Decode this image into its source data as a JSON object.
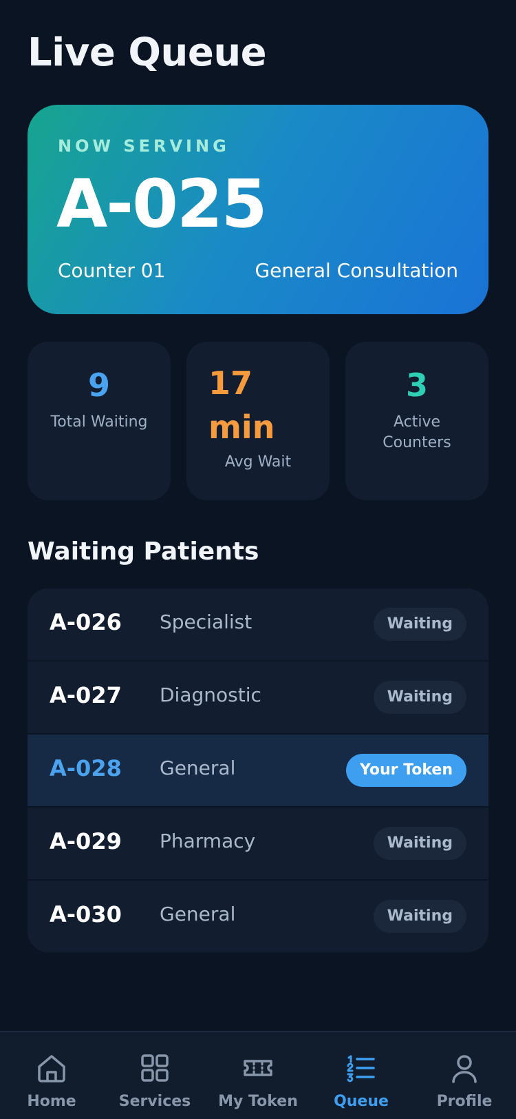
{
  "header": {
    "title": "Live Queue"
  },
  "now_serving": {
    "label": "NOW SERVING",
    "token": "A-025",
    "counter": "Counter 01",
    "service": "General Consultation"
  },
  "stats": [
    {
      "value": "9",
      "label": "Total Waiting",
      "color": "#4ba3f0"
    },
    {
      "value": "17 min",
      "value_line1": "17",
      "value_line2": "min",
      "label": "Avg Wait",
      "color": "#f59a3d"
    },
    {
      "value": "3",
      "label": "Active Counters",
      "label_line1": "Active",
      "label_line2": "Counters",
      "color": "#2ecfb5"
    }
  ],
  "waiting": {
    "title": "Waiting Patients",
    "rows": [
      {
        "token": "A-026",
        "service": "Specialist",
        "status": "Waiting"
      },
      {
        "token": "A-027",
        "service": "Diagnostic",
        "status": "Waiting"
      },
      {
        "token": "A-028",
        "service": "General",
        "status": "Your Token",
        "is_mine": true
      },
      {
        "token": "A-029",
        "service": "Pharmacy",
        "status": "Waiting"
      },
      {
        "token": "A-030",
        "service": "General",
        "status": "Waiting"
      }
    ]
  },
  "nav": {
    "active": "Queue",
    "items": [
      {
        "label": "Home",
        "icon": "home-icon"
      },
      {
        "label": "Services",
        "icon": "grid-icon"
      },
      {
        "label": "My Token",
        "icon": "ticket-icon"
      },
      {
        "label": "Queue",
        "icon": "list-icon"
      },
      {
        "label": "Profile",
        "icon": "user-icon"
      }
    ]
  },
  "colors": {
    "background": "#0b1422",
    "card": "#121d2f",
    "accent": "#3e9ef0",
    "hero_gradient_start": "#17a58f",
    "hero_gradient_end": "#1a73d6"
  }
}
